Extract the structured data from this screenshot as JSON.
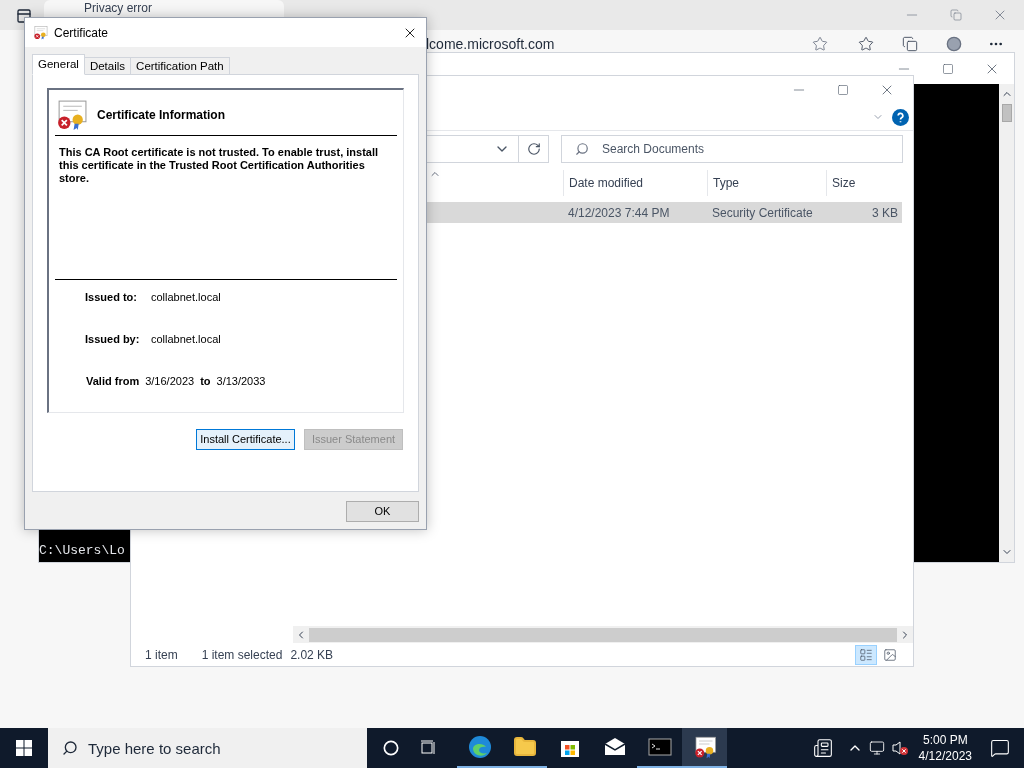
{
  "browser": {
    "tab_title": "Privacy error",
    "address": "lcome.microsoft.com"
  },
  "terminal": {
    "prompt": "C:\\Users\\Lo"
  },
  "explorer": {
    "search": {
      "placeholder": "Search Documents"
    },
    "columns": [
      "Date modified",
      "Type",
      "Size"
    ],
    "rows": [
      {
        "cells": [
          "4/12/2023 7:44 PM",
          "Security Certificate",
          "3 KB"
        ],
        "selected": true
      }
    ],
    "status": {
      "count": "1 item",
      "selection": "1 item selected",
      "size": "2.02 KB"
    },
    "views": [
      {
        "kind": "details",
        "selected": true
      },
      {
        "kind": "large",
        "selected": false
      }
    ]
  },
  "dialog": {
    "title": "Certificate",
    "tabs": [
      {
        "label": "General",
        "selected": true
      },
      {
        "label": "Details",
        "selected": false
      },
      {
        "label": "Certification Path",
        "selected": false
      }
    ],
    "heading": "Certificate Information",
    "message": "This CA Root certificate is not trusted. To enable trust, install this certificate in the Trusted Root Certification Authorities store.",
    "fields": [
      {
        "label": "Issued to:",
        "value": "collabnet.local"
      },
      {
        "label": "Issued by:",
        "value": "collabnet.local"
      }
    ],
    "validity": {
      "label": "Valid from",
      "from": "3/16/2023",
      "to_label": "to",
      "to": "3/13/2033"
    },
    "buttons": [
      {
        "label": "Install Certificate...",
        "disabled": false,
        "hovered": true
      },
      {
        "label": "Issuer Statement",
        "disabled": true,
        "hovered": false
      }
    ],
    "ok": "OK"
  },
  "taskbar": {
    "search": {
      "placeholder": "Type here to search"
    },
    "apps": [
      {
        "kind": "edge",
        "running": true,
        "active": false
      },
      {
        "kind": "folder",
        "running": true,
        "active": false
      },
      {
        "kind": "store",
        "running": false,
        "active": false
      },
      {
        "kind": "mail",
        "running": false,
        "active": false
      },
      {
        "kind": "terminal",
        "running": true,
        "active": false
      },
      {
        "kind": "certificate",
        "running": true,
        "active": true
      }
    ],
    "time": "5:00 PM",
    "date": "4/12/2023"
  }
}
